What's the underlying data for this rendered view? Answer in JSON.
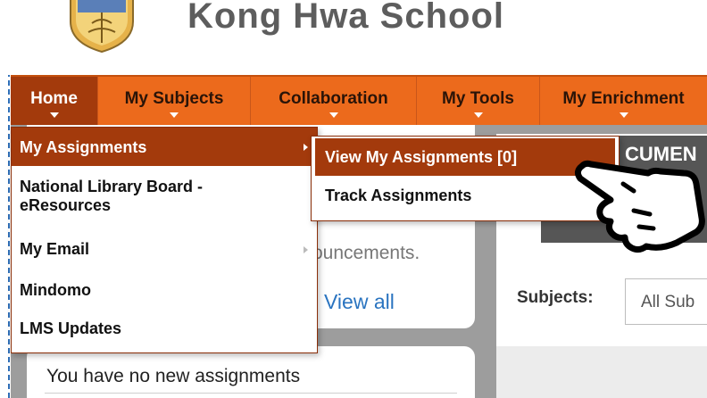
{
  "header": {
    "school_name": "Kong Hwa School"
  },
  "nav": {
    "items": [
      {
        "label": "Home"
      },
      {
        "label": "My Subjects"
      },
      {
        "label": "Collaboration"
      },
      {
        "label": "My Tools"
      },
      {
        "label": "My Enrichment"
      }
    ]
  },
  "home_menu": {
    "items": [
      {
        "label": "My Assignments"
      },
      {
        "label": "National Library Board -",
        "label2": "eResources"
      },
      {
        "label": "My Email"
      },
      {
        "label": "Mindomo"
      },
      {
        "label": "LMS Updates"
      }
    ]
  },
  "assignments_submenu": {
    "items": [
      {
        "label": "View My Assignments [0]"
      },
      {
        "label": "Track Assignments"
      }
    ]
  },
  "announcements": {
    "text": "ouncements.",
    "view_all": "View all"
  },
  "assignments_panel": {
    "text": "You have no new assignments"
  },
  "documents_panel": {
    "title": "CUMEN",
    "subjects_label": "Subjects:",
    "subjects_value": "All Sub"
  },
  "colors": {
    "nav_bg": "#ec6a1c",
    "nav_active": "#a33a0c",
    "link": "#2a74c0"
  },
  "icons": [
    "school-crest-icon",
    "chevron-down-icon",
    "chevron-right-icon",
    "hand-pointer-icon"
  ]
}
